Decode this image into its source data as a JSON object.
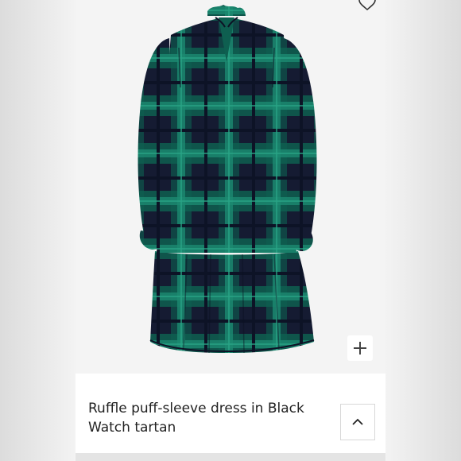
{
  "product": {
    "title": "Ruffle puff-sleeve dress in Black Watch tartan",
    "image_alt": "Green and navy Black Watch tartan ruffle puff-sleeve dress"
  },
  "icons": {
    "favorite": "heart-outline-icon",
    "zoom": "plus-icon",
    "collapse": "chevron-up-icon"
  },
  "colors": {
    "tartan_navy": "#161c33",
    "tartan_green": "#0f6b5a",
    "tartan_teal": "#1d8f76",
    "page_bg": "#f5f5f5"
  }
}
